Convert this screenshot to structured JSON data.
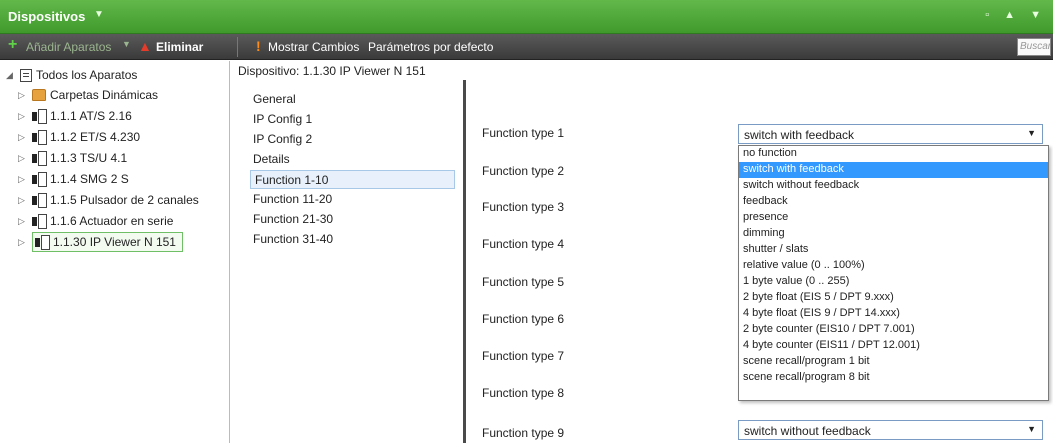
{
  "window": {
    "title": "Dispositivos"
  },
  "toolbar": {
    "add_label": "Añadir Aparatos",
    "delete_label": "Eliminar",
    "show_changes_label": "Mostrar Cambios",
    "defaults_label": "Parámetros por defecto",
    "search_placeholder": "Buscar"
  },
  "tree": {
    "root": "Todos los Aparatos",
    "items": [
      "Carpetas Dinámicas",
      "1.1.1  AT/S 2.16",
      "1.1.2  ET/S 4.230",
      "1.1.3  TS/U 4.1",
      "1.1.4  SMG 2 S",
      "1.1.5  Pulsador de 2 canales",
      "1.1.6  Actuador en serie",
      "1.1.30  IP Viewer N 151"
    ]
  },
  "device": {
    "header": "Dispositivo: 1.1.30  IP Viewer N 151"
  },
  "pages": [
    "General",
    "IP Config 1",
    "IP Config 2",
    "Details",
    "Function 1-10",
    "Function 11-20",
    "Function 21-30",
    "Function 31-40"
  ],
  "params": {
    "labels": [
      "Function type 1",
      "Function type 2",
      "Function type 3",
      "Function type 4",
      "Function type 5",
      "Function type 6",
      "Function type 7",
      "Function type 8",
      "Function type 9"
    ],
    "value_1": "switch with feedback",
    "value_9": "switch without feedback"
  },
  "dropdown_options": [
    "no function",
    "switch with feedback",
    "switch without feedback",
    "feedback",
    "presence",
    "dimming",
    "shutter / slats",
    "relative value (0 .. 100%)",
    "1 byte value (0 .. 255)",
    "2 byte float (EIS 5 / DPT 9.xxx)",
    "4 byte float (EIS 9 / DPT 14.xxx)",
    "2 byte counter (EIS10 / DPT 7.001)",
    "4 byte counter (EIS11 / DPT 12.001)",
    "scene recall/program 1 bit",
    "scene recall/program 8 bit"
  ],
  "colors": {
    "titlebar": "#4ea83a",
    "toolbar": "#4a4a4a",
    "selection": "#3399ff"
  }
}
